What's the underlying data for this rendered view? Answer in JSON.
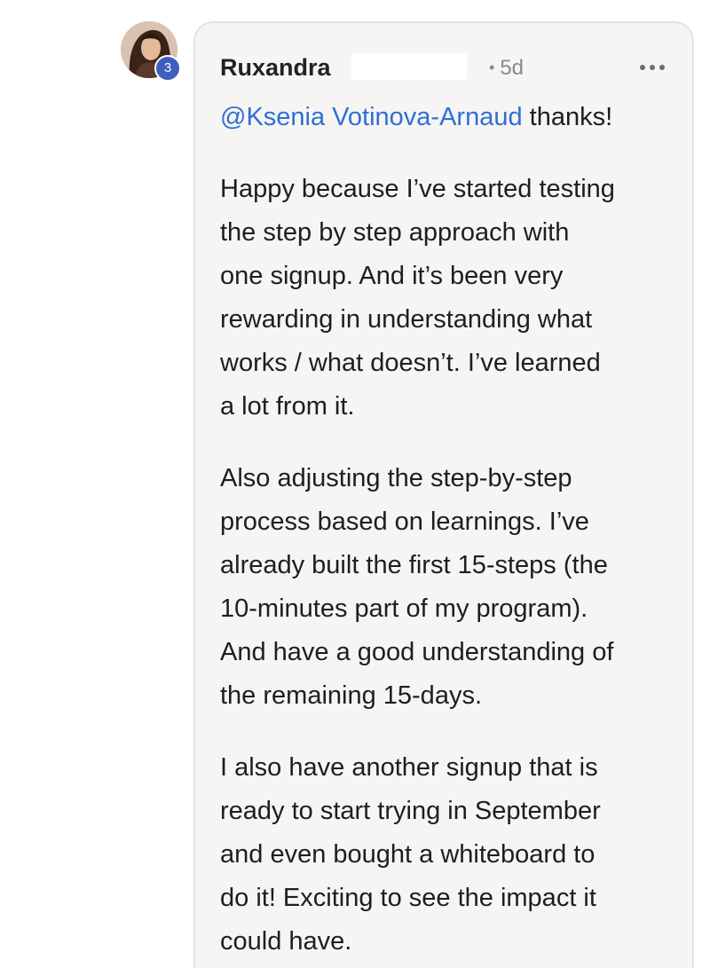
{
  "post": {
    "author": "Ruxandra",
    "level_badge": "3",
    "timestamp": "5d",
    "mention": "@Ksenia Votinova-Arnaud",
    "mention_suffix": " thanks!",
    "paragraphs": [
      "Happy because I’ve started testing\nthe step by step approach with\none signup. And it’s been very\nrewarding in understanding what\nworks / what doesn’t. I’ve learned\na lot from it.",
      "Also adjusting the step-by-step\nprocess based on learnings. I’ve\nalready built the first 15-steps (the\n10-minutes part of my program).\nAnd have a good understanding of\nthe remaining 15-days.",
      "I also have another signup that is\nready to start trying in September\nand even bought a whiteboard to\ndo it! Exciting to see the impact it\ncould have."
    ]
  },
  "colors": {
    "card_background": "#f6f5f4",
    "mention": "#2f6fd6",
    "badge": "#3f5fbf"
  },
  "icons": {
    "more": "more-horizontal-icon"
  }
}
